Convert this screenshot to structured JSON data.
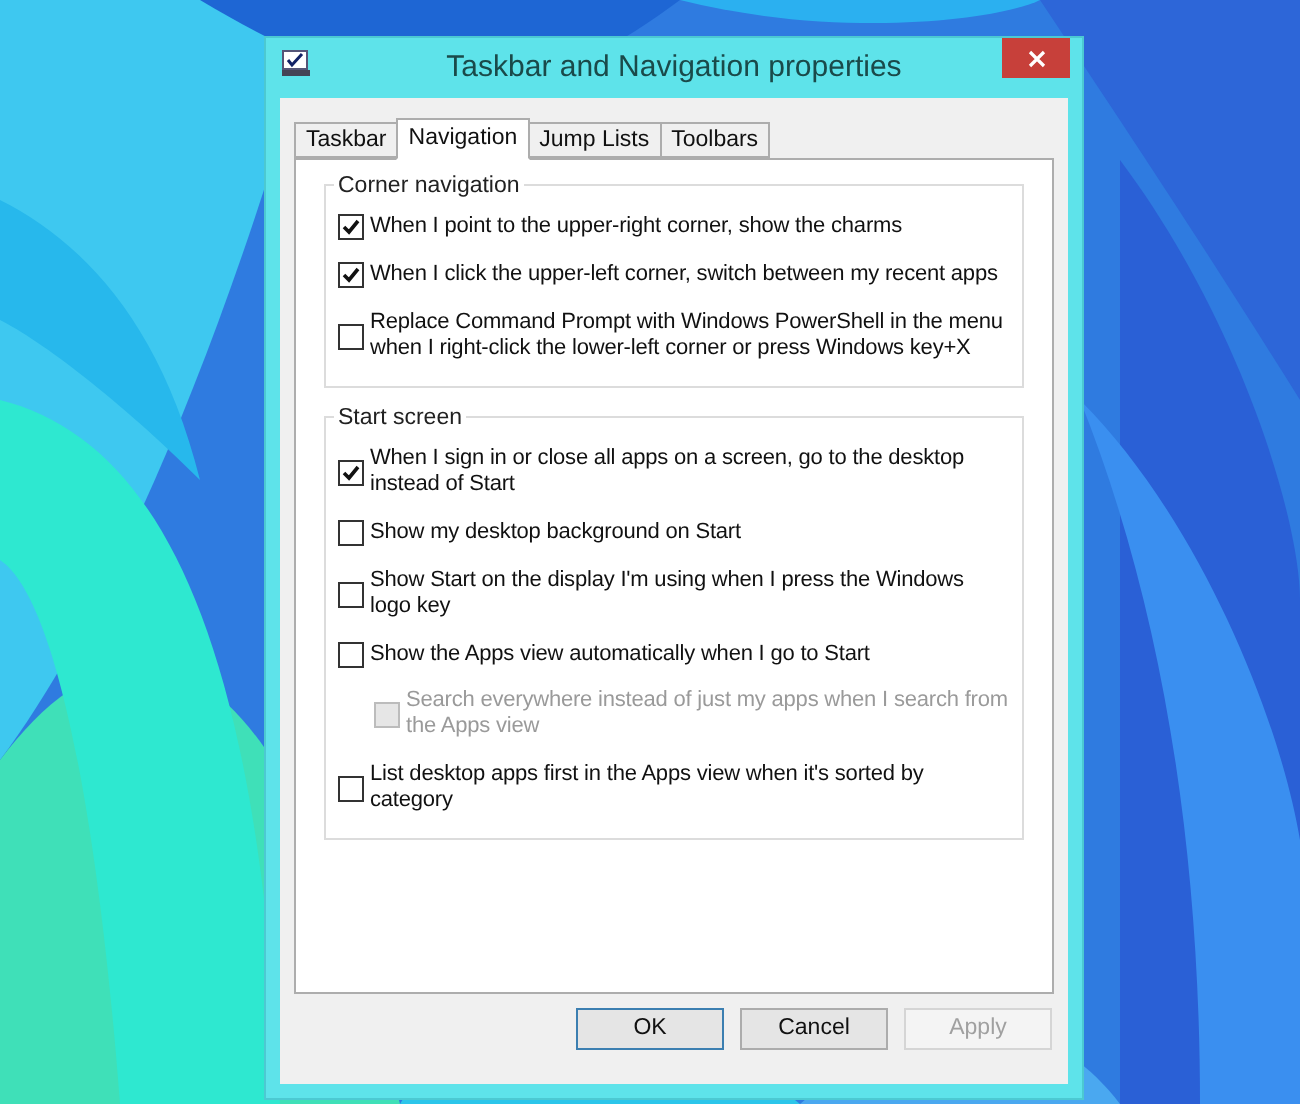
{
  "window": {
    "title": "Taskbar and Navigation properties"
  },
  "tabs": [
    {
      "label": "Taskbar",
      "selected": false
    },
    {
      "label": "Navigation",
      "selected": true
    },
    {
      "label": "Jump Lists",
      "selected": false
    },
    {
      "label": "Toolbars",
      "selected": false
    }
  ],
  "groups": [
    {
      "title": "Corner navigation",
      "options": [
        {
          "label": "When I point to the upper-right corner, show the charms",
          "checked": true,
          "disabled": false
        },
        {
          "label": "When I click the upper-left corner, switch between my recent apps",
          "checked": true,
          "disabled": false
        },
        {
          "label": "Replace Command Prompt with Windows PowerShell in the menu when I right-click the lower-left corner or press Windows key+X",
          "checked": false,
          "disabled": false
        }
      ]
    },
    {
      "title": "Start screen",
      "options": [
        {
          "label": "When I sign in or close all apps on a screen, go to the desktop instead of Start",
          "checked": true,
          "disabled": false
        },
        {
          "label": "Show my desktop background on Start",
          "checked": false,
          "disabled": false
        },
        {
          "label": "Show Start on the display I'm using when I press the Windows logo key",
          "checked": false,
          "disabled": false
        },
        {
          "label": "Show the Apps view automatically when I go to Start",
          "checked": false,
          "disabled": false,
          "children": [
            {
              "label": "Search everywhere instead of just my apps when I search from the Apps view",
              "checked": false,
              "disabled": true
            }
          ]
        },
        {
          "label": "List desktop apps first in the Apps view when it's sorted by category",
          "checked": false,
          "disabled": false
        }
      ]
    }
  ],
  "buttons": [
    {
      "label": "OK",
      "kind": "default",
      "disabled": false
    },
    {
      "label": "Cancel",
      "kind": "normal",
      "disabled": false
    },
    {
      "label": "Apply",
      "kind": "normal",
      "disabled": true
    }
  ]
}
